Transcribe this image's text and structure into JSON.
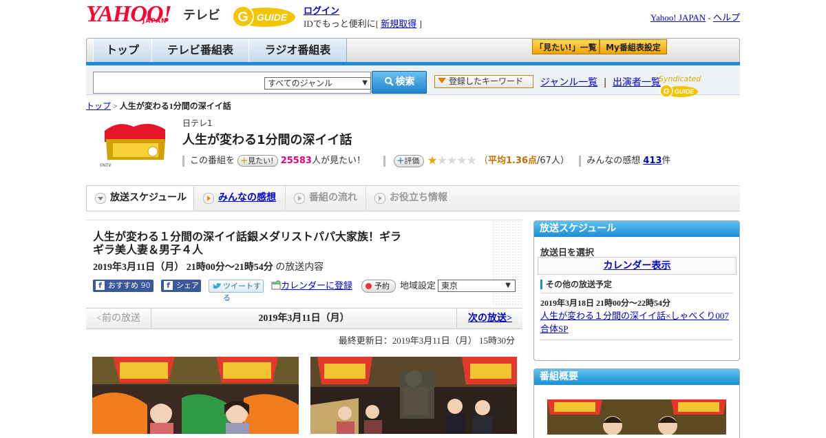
{
  "header": {
    "logo_text": "YAHOO!",
    "logo_sub": "JAPAN",
    "service_name": "テレビ",
    "gguide_text": "G GUIDE",
    "login_label": "ログイン",
    "login_prompt": "IDでもっと便利に[",
    "signup_label": "新規取得",
    "signup_suffix": "]",
    "yahoo_japan_link": "Yahoo! JAPAN",
    "link_sep": "-",
    "help_link": "ヘルプ"
  },
  "nav": {
    "tabs": [
      {
        "label": "トップ"
      },
      {
        "label": "テレビ番組表"
      },
      {
        "label": "ラジオ番組表"
      }
    ],
    "mitai_list": "「見たい!」一覧",
    "my_schedule": "My番組表設定"
  },
  "search": {
    "genre_selected": "すべてのジャンル",
    "search_button": "検索",
    "keyword_button": "登録したキーワード",
    "genre_list_link": "ジャンル一覧",
    "divider": "|",
    "performer_list_link": "出演者一覧",
    "syndicated": "Syndicated"
  },
  "breadcrumb": {
    "top_link": "トップ",
    "sep": ">",
    "current": "人生が変わる1分間の深イイ話"
  },
  "program": {
    "channel": "日テレ1",
    "title": "人生が変わる1分間の深イイ話",
    "thumb_caption": "©NTV",
    "kono_bangumi": "この番組を",
    "mitai_button": "見たい!",
    "mitai_count": "25583",
    "mitai_suffix": "人が見たい！",
    "hyoka_button": "評価",
    "rating": 1.36,
    "rating_max": 5,
    "avg_open": "（",
    "avg_label": "平均1.36点",
    "avg_count": "/67人）",
    "kansou_label": "みんなの感想",
    "kansou_count": "413",
    "kansou_suffix": "件"
  },
  "tabs": [
    {
      "label": "放送スケジュール",
      "active": true
    },
    {
      "label": "みんなの感想",
      "link": true
    },
    {
      "label": "番組の流れ"
    },
    {
      "label": "お役立ち情報"
    }
  ],
  "episode": {
    "title": "人生が変わる１分間の深イイ話銀メダリストパパ大家族！ギラギラ美人妻＆男子４人",
    "date": "2019年3月11日（月） 21時00分～21時54分",
    "date_suffix": "の放送内容",
    "fb_recommend": "おすすめ",
    "fb_count": "90",
    "fb_share": "シェア",
    "tweet": "ツイートする",
    "calendar_register": "カレンダーに登録",
    "reserve": "予約",
    "region_label": "地域設定",
    "region_selected": "東京",
    "prev_label": "<前の放送",
    "current_date": "2019年3月11日（月）",
    "next_label": "次の放送>",
    "updated": "最終更新日：2019年3月11日（月） 15時30分"
  },
  "sidebar": {
    "schedule_head": "放送スケジュール",
    "select_date": "放送日を選択",
    "calendar_link": "カレンダー表示",
    "other_head": "その他の放送予定",
    "other_date": "2019年3月18日 21時00分～22時54分",
    "other_link": "人生が変わる１分間の深イイ話×しゃべくり007合体SP",
    "overview_head": "番組概要"
  },
  "colors": {
    "accent_blue": "#1f8bd6",
    "yahoo_red": "#ff0033",
    "pink_count": "#e6007a"
  }
}
